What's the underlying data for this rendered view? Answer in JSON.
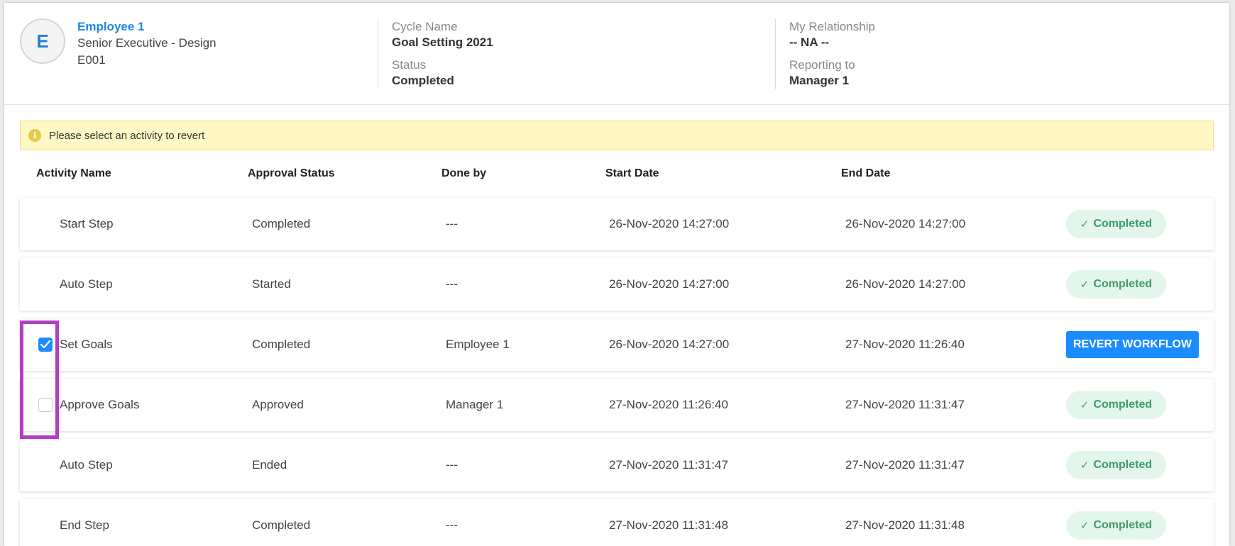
{
  "employee": {
    "avatar_initial": "E",
    "name": "Employee 1",
    "title": "Senior Executive - Design",
    "id": "E001"
  },
  "cycle": {
    "name_label": "Cycle Name",
    "name_value": "Goal Setting 2021",
    "status_label": "Status",
    "status_value": "Completed"
  },
  "relationship": {
    "label": "My Relationship",
    "value": "-- NA --",
    "reporting_label": "Reporting to",
    "reporting_value": "Manager 1"
  },
  "notice": {
    "icon": "info-icon",
    "icon_glyph": "i",
    "text": "Please select an activity to revert"
  },
  "table": {
    "headers": [
      "Activity Name",
      "Approval Status",
      "Done by",
      "Start Date",
      "End Date"
    ],
    "completed_label": "Completed",
    "revert_label": "Revert Workflow",
    "rows": [
      {
        "name": "Start Step",
        "approval": "Completed",
        "done_by": "---",
        "start": "26-Nov-2020 14:27:00",
        "end": "26-Nov-2020 14:27:00",
        "action": "badge",
        "checkbox": "none"
      },
      {
        "name": "Auto Step",
        "approval": "Started",
        "done_by": "---",
        "start": "26-Nov-2020 14:27:00",
        "end": "26-Nov-2020 14:27:00",
        "action": "badge",
        "checkbox": "none"
      },
      {
        "name": "Set Goals",
        "approval": "Completed",
        "done_by": "Employee 1",
        "start": "26-Nov-2020 14:27:00",
        "end": "27-Nov-2020 11:26:40",
        "action": "revert",
        "checkbox": "checked"
      },
      {
        "name": "Approve Goals",
        "approval": "Approved",
        "done_by": "Manager 1",
        "start": "27-Nov-2020 11:26:40",
        "end": "27-Nov-2020 11:31:47",
        "action": "badge",
        "checkbox": "unchecked"
      },
      {
        "name": "Auto Step",
        "approval": "Ended",
        "done_by": "---",
        "start": "27-Nov-2020 11:31:47",
        "end": "27-Nov-2020 11:31:47",
        "action": "badge",
        "checkbox": "none"
      },
      {
        "name": "End Step",
        "approval": "Completed",
        "done_by": "---",
        "start": "27-Nov-2020 11:31:48",
        "end": "27-Nov-2020 11:31:48",
        "action": "badge",
        "checkbox": "none"
      }
    ]
  },
  "colors": {
    "accent": "#1a8cff",
    "link": "#1a87e6",
    "badge_bg": "#e3f6ec",
    "badge_text": "#3f9a68",
    "notice_bg": "#fff8c5",
    "highlight": "#b23ec3"
  }
}
